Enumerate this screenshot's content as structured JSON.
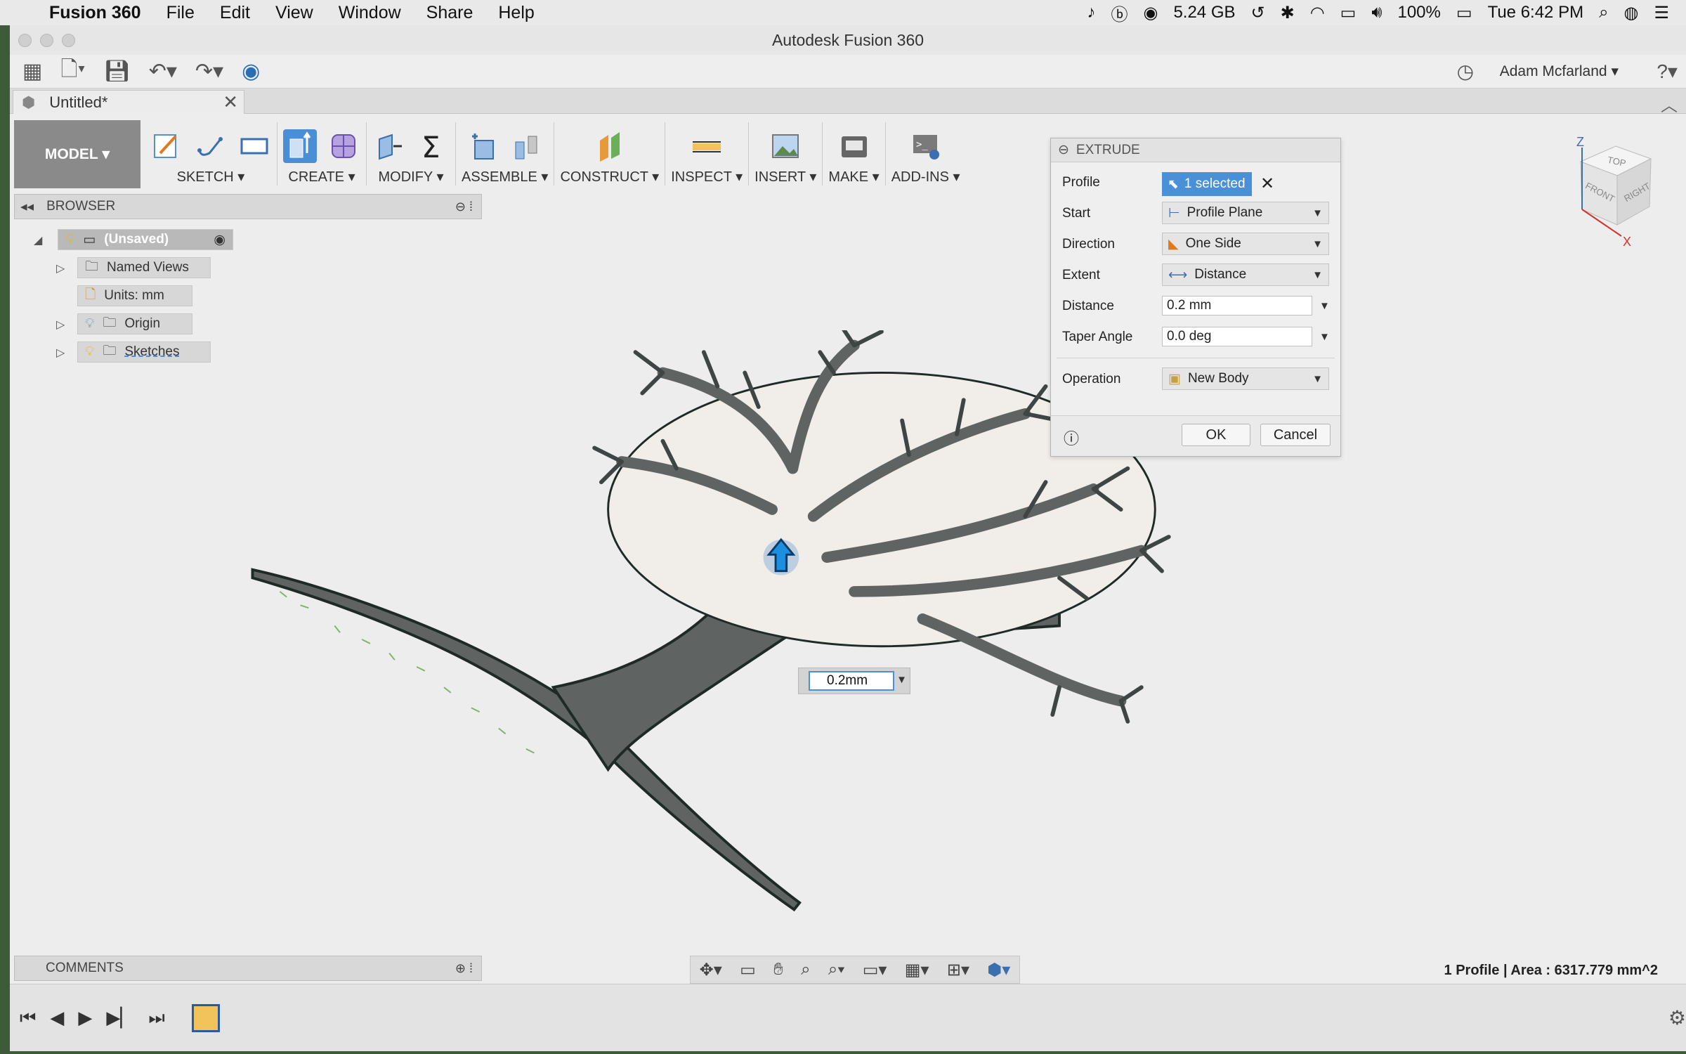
{
  "menubar": {
    "app_name": "Fusion 360",
    "items": [
      "File",
      "Edit",
      "View",
      "Window",
      "Share",
      "Help"
    ],
    "status": {
      "memory": "5.24 GB",
      "battery": "100%",
      "clock": "Tue 6:42 PM"
    }
  },
  "window": {
    "title": "Autodesk Fusion 360",
    "user": "Adam Mcfarland",
    "tab_title": "Untitled*"
  },
  "ribbon": {
    "workspace": "MODEL",
    "groups": [
      "SKETCH",
      "CREATE",
      "MODIFY",
      "ASSEMBLE",
      "CONSTRUCT",
      "INSPECT",
      "INSERT",
      "MAKE",
      "ADD-INS"
    ]
  },
  "browser": {
    "title": "BROWSER",
    "root": "(Unsaved)",
    "named_views": "Named Views",
    "units": "Units: mm",
    "origin": "Origin",
    "sketches": "Sketches"
  },
  "extrude": {
    "title": "EXTRUDE",
    "profile_label": "Profile",
    "profile_value": "1 selected",
    "start_label": "Start",
    "start_value": "Profile Plane",
    "direction_label": "Direction",
    "direction_value": "One Side",
    "extent_label": "Extent",
    "extent_value": "Distance",
    "distance_label": "Distance",
    "distance_value": "0.2 mm",
    "taper_label": "Taper Angle",
    "taper_value": "0.0 deg",
    "operation_label": "Operation",
    "operation_value": "New Body",
    "ok_label": "OK",
    "cancel_label": "Cancel"
  },
  "viewport": {
    "dimension_input": "0.2mm",
    "viewcube_faces": [
      "TOP",
      "FRONT",
      "RIGHT"
    ],
    "axis_z": "Z",
    "axis_x": "X"
  },
  "comments": {
    "title": "COMMENTS"
  },
  "status": {
    "info": "1 Profile | Area : 6317.779 mm^2"
  },
  "colors": {
    "accent": "#4a90d9",
    "tree_fill": "#5f6463",
    "tree_outline": "#1f2a26",
    "viewport_bg": "#ededed"
  }
}
